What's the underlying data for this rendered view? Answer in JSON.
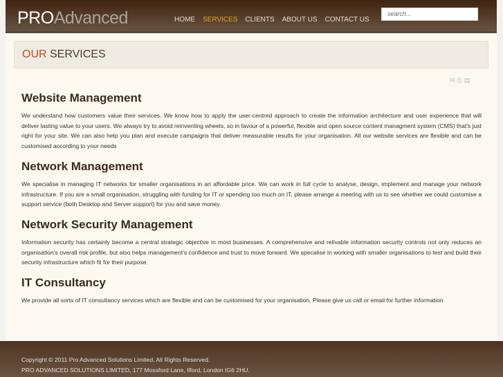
{
  "header": {
    "logo_pro": "PRO",
    "logo_advanced": "Advanced",
    "nav": [
      "HOME",
      "SERVICES",
      "CLIENTS",
      "ABOUT US",
      "CONTACT US"
    ],
    "active_nav": "SERVICES",
    "search_placeholder": "search..."
  },
  "page": {
    "title_accent": "OUR",
    "title_rest": " SERVICES"
  },
  "sections": [
    {
      "heading": "Website Management",
      "text": "We understand how customers value their services. We know how to apply the user-centred approach to create the information architecture and user experience that will deliver lasting value to your users. We always try to avoid reinventing wheels, so in favour of a powerful, flexible and open source content managment system (CMS) that's just right for your site.  We can also help you plan and execute campaigns that deliver measurable results for your organisation. All our website services are flexible and can be customised according to your needs"
    },
    {
      "heading": "Network Management",
      "text": "We specialise in managing IT networks for smaller organisations in an affordable price. We can work in full cycle to analyse, design, implement and manage your network infrastructure. If you are a small organisation, struggling with funding for IT or spending too much on IT, please arrange a meeting with us to see whether we could customise a support service (both Desktop and Server support) for you and save money."
    },
    {
      "heading": "Network Security Management",
      "text": "Information security has certainly become a central strategic objective in most businesses. A comprehensive and relivable information security controls not only reduces an organisation's overall risk profile, but also helps management's confidence and trust to move forward. We specalise in working with smaller organisations to test and build their security infrastructure which fit for their purpose."
    },
    {
      "heading": "IT Consultancy",
      "text": "We provide all sorts of IT consultancy services which are flexible and can be customised for your organisation. Please give us call or email for further information"
    }
  ],
  "footer": {
    "copyright": "Copyright © 2011 Pro Advanced Solutions Limited. All Rights Reserved.",
    "address": "PRO ADVANCED SOLUTIONS LIMITED, 177 Mossford Lane, Ilford, London IG6 2HU."
  }
}
